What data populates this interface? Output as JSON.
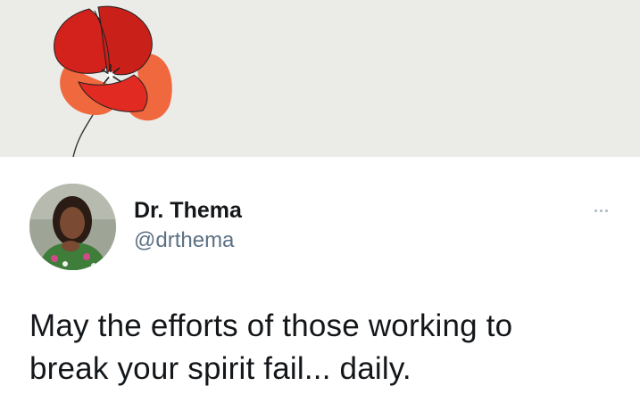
{
  "header": {
    "image": "poppy-flower-illustration",
    "background": "#ebebe8"
  },
  "tweet": {
    "display_name": "Dr. Thema",
    "handle": "@drthema",
    "text_lines": [
      "May the efforts of those working to",
      "break your spirit fail... daily."
    ],
    "more_icon": "ellipsis-icon"
  },
  "colors": {
    "text_primary": "#14171a",
    "text_secondary": "#5b7083",
    "poppy_red": "#d3211b",
    "poppy_orange": "#f0683d"
  }
}
